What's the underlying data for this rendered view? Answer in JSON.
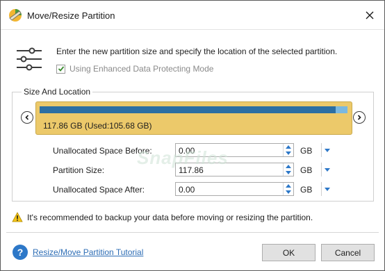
{
  "window": {
    "title": "Move/Resize Partition"
  },
  "instruction": "Enter the new partition size and specify the location of the selected partition.",
  "checkbox": {
    "label": "Using Enhanced Data Protecting Mode",
    "checked": true
  },
  "size_location": {
    "group_title": "Size And Location",
    "partition": {
      "label": "117.86 GB (Used:105.68 GB)",
      "used_fraction": 0.962,
      "block_color": "#ecc96a",
      "used_color": "#2c6fa3",
      "free_color": "#7ab8e0"
    },
    "fields": [
      {
        "label": "Unallocated Space Before:",
        "value": "0.00",
        "unit": "GB"
      },
      {
        "label": "Partition Size:",
        "value": "117.86",
        "unit": "GB"
      },
      {
        "label": "Unallocated Space After:",
        "value": "0.00",
        "unit": "GB"
      }
    ]
  },
  "warning": "It's recommended to backup your data before moving or resizing the partition.",
  "footer": {
    "help_glyph": "?",
    "tutorial_link": "Resize/Move Partition Tutorial",
    "ok_label": "OK",
    "cancel_label": "Cancel"
  },
  "watermark": "SnapFiles",
  "icons": {
    "app": "partition-wizard-icon",
    "close": "close-icon",
    "settings": "sliders-icon",
    "warning": "warning-icon",
    "help": "help-icon"
  }
}
